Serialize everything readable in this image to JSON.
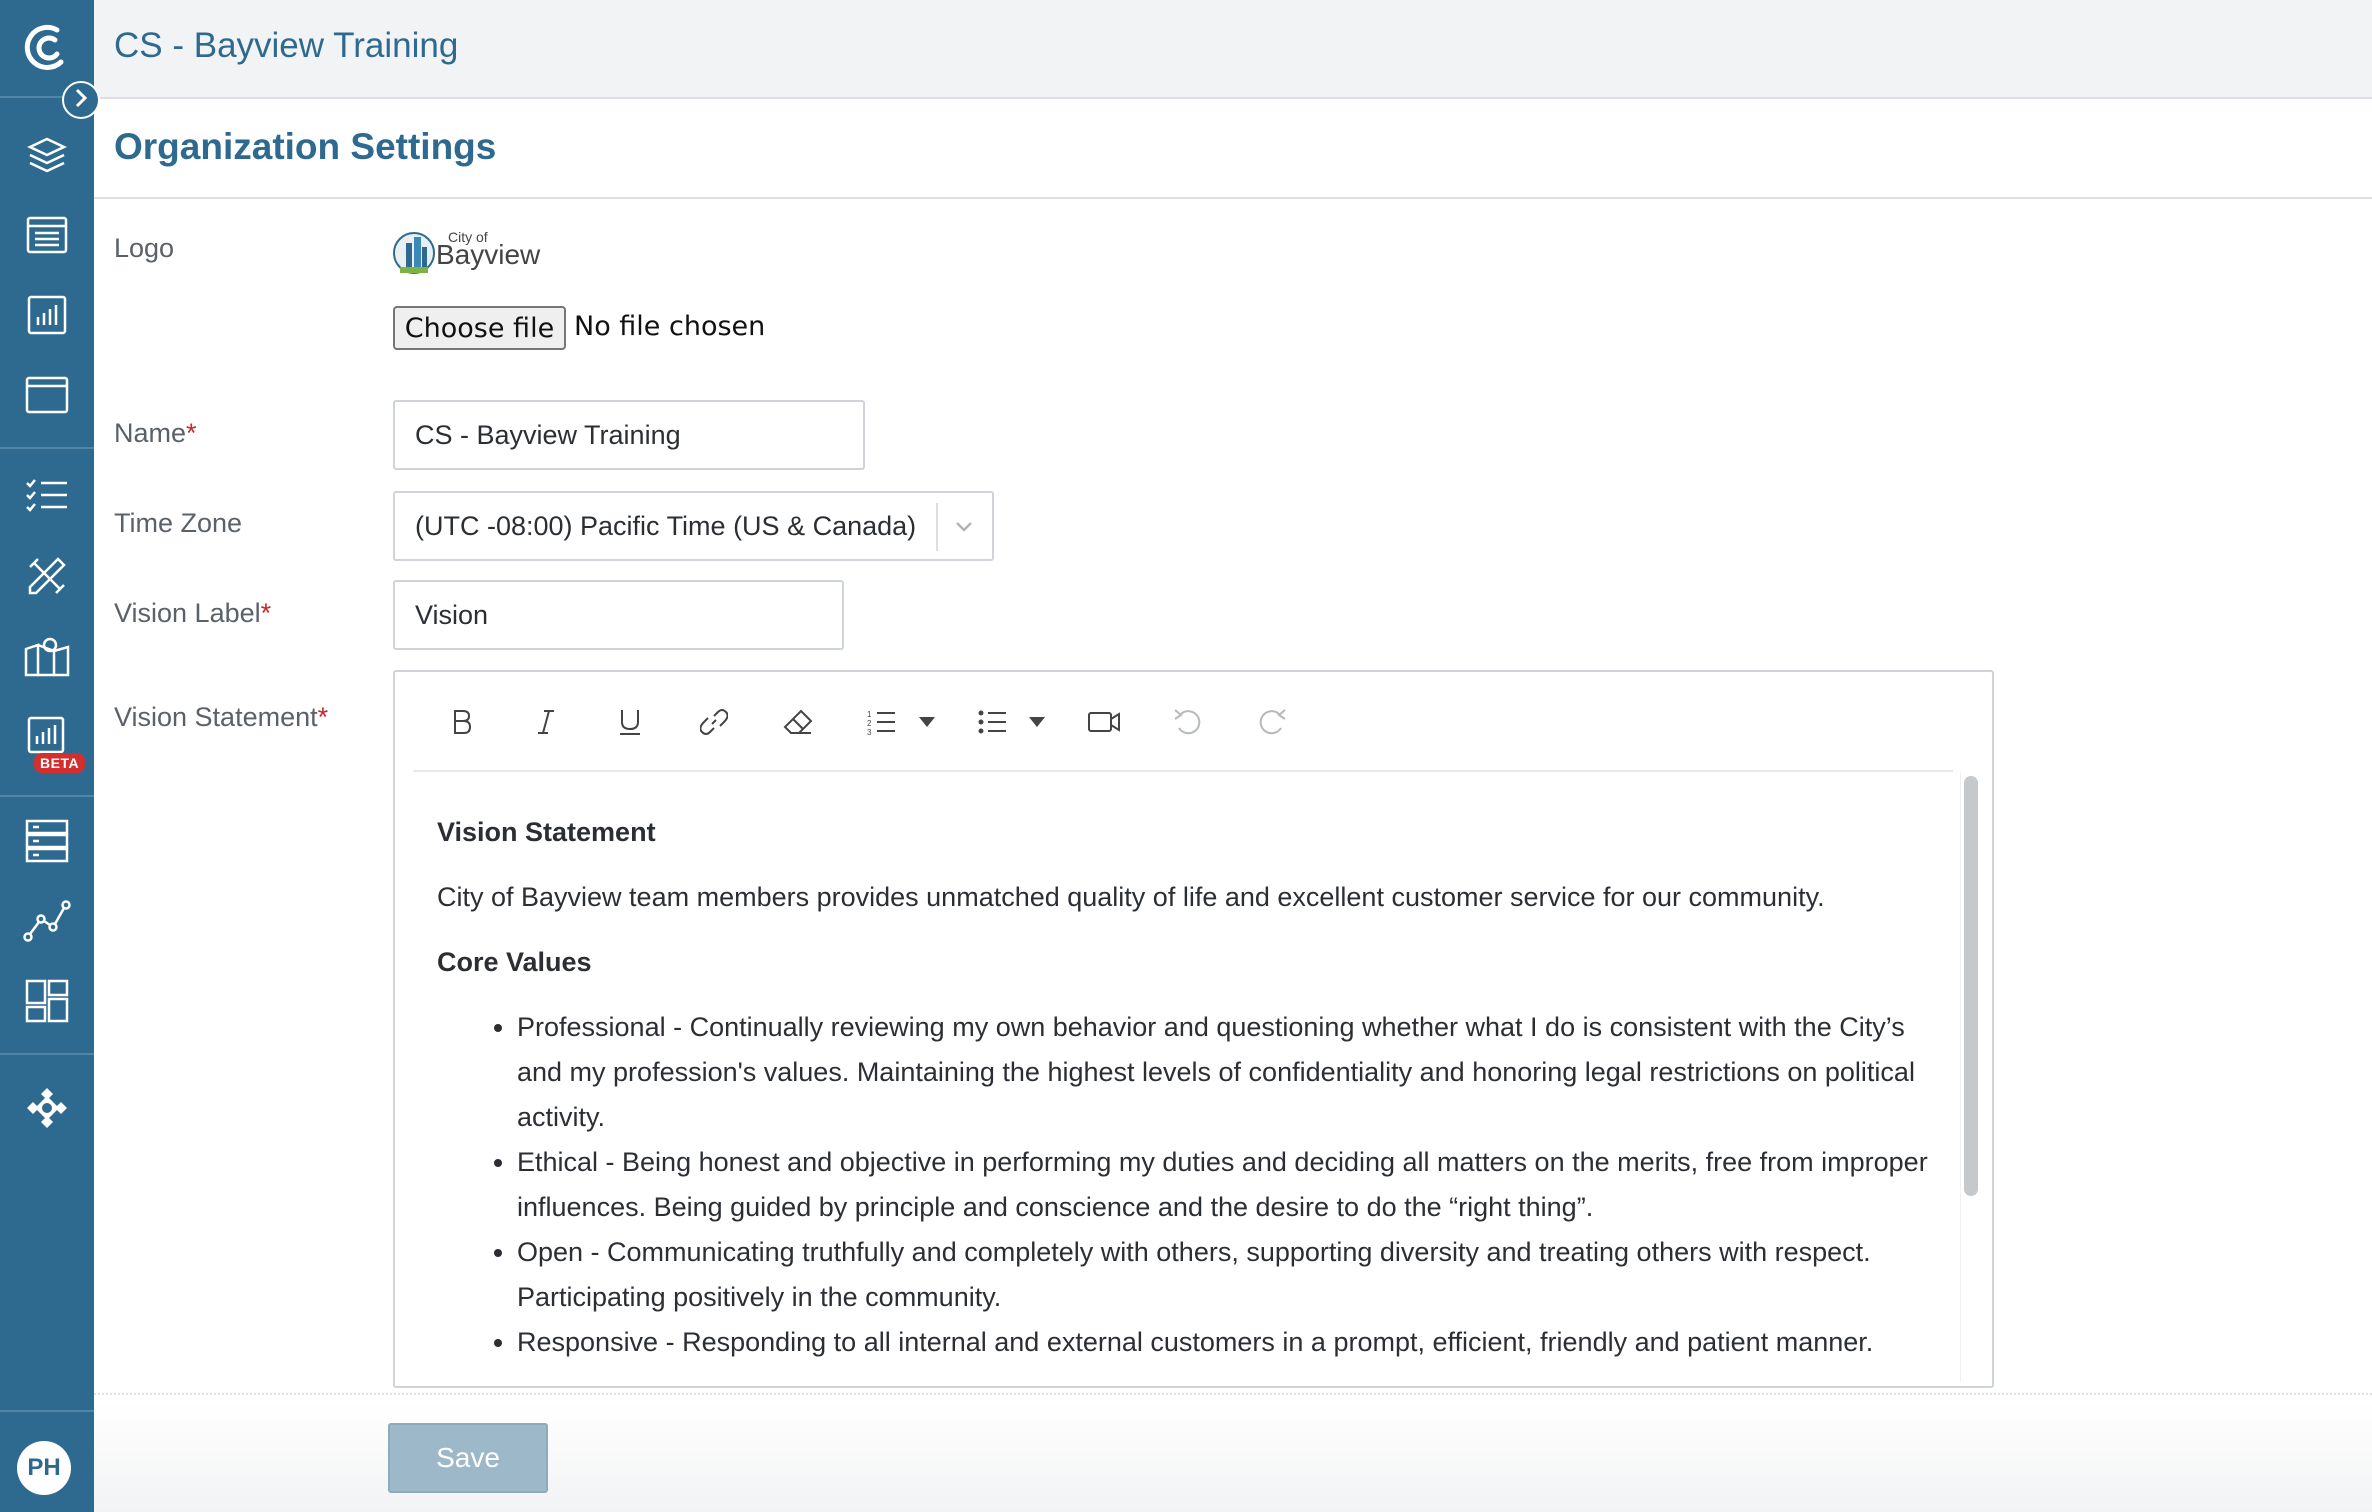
{
  "header": {
    "org_title": "CS - Bayview Training"
  },
  "page": {
    "title": "Organization Settings"
  },
  "sidebar": {
    "items": [
      {
        "icon": "layers-icon"
      },
      {
        "icon": "document-list-icon"
      },
      {
        "icon": "bar-chart-icon"
      },
      {
        "icon": "browser-window-icon"
      },
      {
        "icon": "checklist-icon"
      },
      {
        "icon": "tools-icon"
      },
      {
        "icon": "map-icon"
      },
      {
        "icon": "beta-chart-icon",
        "badge": "BETA"
      },
      {
        "icon": "server-stack-icon"
      },
      {
        "icon": "path-nodes-icon"
      },
      {
        "icon": "dashboard-grid-icon"
      },
      {
        "icon": "puzzle-settings-icon"
      }
    ],
    "avatar_initials": "PH"
  },
  "form": {
    "logo_label": "Logo",
    "logo_text_small": "City of",
    "logo_text_big": "Bayview",
    "choose_file_label": "Choose file",
    "no_file_text": "No file chosen",
    "name_label": "Name",
    "name_value": "CS - Bayview Training",
    "timezone_label": "Time Zone",
    "timezone_value": "(UTC -08:00) Pacific Time (US & Canada)",
    "vision_label_label": "Vision Label",
    "vision_label_value": "Vision",
    "vision_statement_label": "Vision Statement",
    "required_mark": "*"
  },
  "editor": {
    "heading1": "Vision Statement",
    "paragraph1": "City of Bayview team members provides unmatched quality of life and excellent customer service for our community.",
    "heading2": "Core Values",
    "bullets": [
      "Professional - Continually reviewing my own behavior and questioning whether what I do is consistent with the City’s and my profession's values. Maintaining the highest levels of confidentiality and honoring legal restrictions on political activity.",
      "Ethical - Being honest and objective in performing my duties and deciding all matters on the merits, free from improper influences. Being guided by principle and conscience and the desire to do the “right thing”.",
      "Open - Communicating truthfully and completely with others, supporting diversity and treating others with respect. Participating positively in the community.",
      "Responsive - Responding to all internal and external customers in a prompt, efficient, friendly and patient manner."
    ]
  },
  "actions": {
    "save_label": "Save"
  },
  "colors": {
    "sidebar": "#2e6a90",
    "accent": "#2e6a90",
    "required": "#c62828",
    "save_disabled": "#9db8c8"
  }
}
